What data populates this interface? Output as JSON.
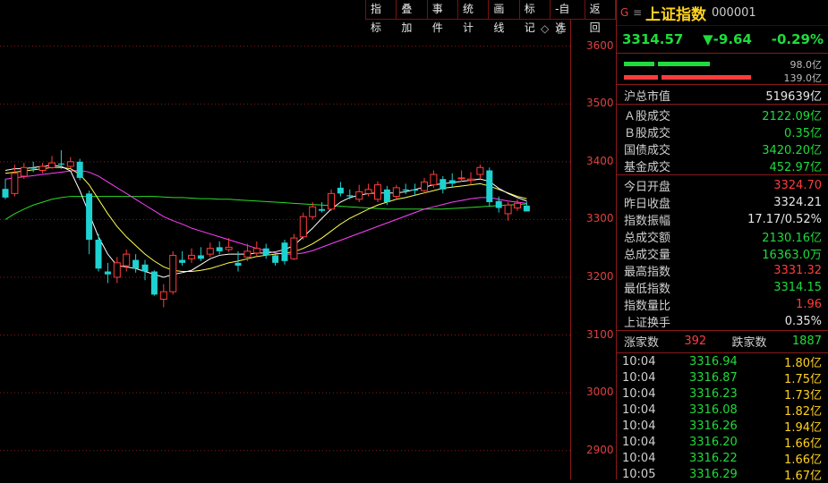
{
  "toolbar": [
    "指标",
    "叠加",
    "事件",
    "统计",
    "画线",
    "标记",
    "-自选",
    "返回"
  ],
  "chart_icons": [
    "◇",
    "▯"
  ],
  "chart_data": {
    "type": "candlestick",
    "y_ticks": [
      3600,
      3500,
      3400,
      3300,
      3200,
      3100,
      3000,
      2900
    ],
    "ylim": [
      2850,
      3680
    ],
    "candles": [
      {
        "o": 3353,
        "c": 3338,
        "h": 3370,
        "l": 3335
      },
      {
        "o": 3345,
        "c": 3380,
        "h": 3395,
        "l": 3340
      },
      {
        "o": 3375,
        "c": 3390,
        "h": 3398,
        "l": 3370
      },
      {
        "o": 3390,
        "c": 3388,
        "h": 3400,
        "l": 3382
      },
      {
        "o": 3385,
        "c": 3392,
        "h": 3398,
        "l": 3380
      },
      {
        "o": 3390,
        "c": 3398,
        "h": 3410,
        "l": 3388
      },
      {
        "o": 3397,
        "c": 3395,
        "h": 3420,
        "l": 3388
      },
      {
        "o": 3392,
        "c": 3400,
        "h": 3408,
        "l": 3388
      },
      {
        "o": 3400,
        "c": 3372,
        "h": 3405,
        "l": 3368
      },
      {
        "o": 3345,
        "c": 3265,
        "h": 3350,
        "l": 3240
      },
      {
        "o": 3265,
        "c": 3215,
        "h": 3275,
        "l": 3210
      },
      {
        "o": 3210,
        "c": 3205,
        "h": 3225,
        "l": 3190
      },
      {
        "o": 3200,
        "c": 3225,
        "h": 3235,
        "l": 3190
      },
      {
        "o": 3220,
        "c": 3240,
        "h": 3248,
        "l": 3210
      },
      {
        "o": 3230,
        "c": 3215,
        "h": 3240,
        "l": 3208
      },
      {
        "o": 3222,
        "c": 3210,
        "h": 3230,
        "l": 3195
      },
      {
        "o": 3210,
        "c": 3170,
        "h": 3212,
        "l": 3168
      },
      {
        "o": 3162,
        "c": 3175,
        "h": 3188,
        "l": 3148
      },
      {
        "o": 3175,
        "c": 3238,
        "h": 3245,
        "l": 3170
      },
      {
        "o": 3230,
        "c": 3225,
        "h": 3245,
        "l": 3220
      },
      {
        "o": 3232,
        "c": 3238,
        "h": 3250,
        "l": 3225
      },
      {
        "o": 3238,
        "c": 3232,
        "h": 3252,
        "l": 3228
      },
      {
        "o": 3240,
        "c": 3250,
        "h": 3260,
        "l": 3235
      },
      {
        "o": 3252,
        "c": 3245,
        "h": 3262,
        "l": 3240
      },
      {
        "o": 3248,
        "c": 3252,
        "h": 3268,
        "l": 3244
      },
      {
        "o": 3225,
        "c": 3220,
        "h": 3245,
        "l": 3210
      },
      {
        "o": 3235,
        "c": 3245,
        "h": 3258,
        "l": 3228
      },
      {
        "o": 3242,
        "c": 3250,
        "h": 3262,
        "l": 3236
      },
      {
        "o": 3250,
        "c": 3238,
        "h": 3258,
        "l": 3232
      },
      {
        "o": 3238,
        "c": 3225,
        "h": 3245,
        "l": 3220
      },
      {
        "o": 3260,
        "c": 3228,
        "h": 3265,
        "l": 3222
      },
      {
        "o": 3232,
        "c": 3268,
        "h": 3275,
        "l": 3230
      },
      {
        "o": 3270,
        "c": 3305,
        "h": 3312,
        "l": 3265
      },
      {
        "o": 3305,
        "c": 3322,
        "h": 3330,
        "l": 3300
      },
      {
        "o": 3318,
        "c": 3315,
        "h": 3330,
        "l": 3312
      },
      {
        "o": 3318,
        "c": 3345,
        "h": 3352,
        "l": 3315
      },
      {
        "o": 3355,
        "c": 3345,
        "h": 3365,
        "l": 3340
      },
      {
        "o": 3342,
        "c": 3340,
        "h": 3352,
        "l": 3335
      },
      {
        "o": 3335,
        "c": 3348,
        "h": 3360,
        "l": 3330
      },
      {
        "o": 3345,
        "c": 3352,
        "h": 3362,
        "l": 3340
      },
      {
        "o": 3335,
        "c": 3360,
        "h": 3366,
        "l": 3330
      },
      {
        "o": 3352,
        "c": 3330,
        "h": 3358,
        "l": 3325
      },
      {
        "o": 3340,
        "c": 3355,
        "h": 3360,
        "l": 3335
      },
      {
        "o": 3352,
        "c": 3350,
        "h": 3362,
        "l": 3344
      },
      {
        "o": 3352,
        "c": 3350,
        "h": 3362,
        "l": 3342
      },
      {
        "o": 3350,
        "c": 3365,
        "h": 3372,
        "l": 3345
      },
      {
        "o": 3360,
        "c": 3378,
        "h": 3385,
        "l": 3355
      },
      {
        "o": 3370,
        "c": 3352,
        "h": 3375,
        "l": 3345
      },
      {
        "o": 3368,
        "c": 3362,
        "h": 3380,
        "l": 3355
      },
      {
        "o": 3372,
        "c": 3372,
        "h": 3385,
        "l": 3365
      },
      {
        "o": 3368,
        "c": 3370,
        "h": 3382,
        "l": 3360
      },
      {
        "o": 3378,
        "c": 3390,
        "h": 3395,
        "l": 3370
      },
      {
        "o": 3385,
        "c": 3330,
        "h": 3390,
        "l": 3322
      },
      {
        "o": 3332,
        "c": 3320,
        "h": 3340,
        "l": 3312
      },
      {
        "o": 3310,
        "c": 3325,
        "h": 3330,
        "l": 3298
      },
      {
        "o": 3320,
        "c": 3328,
        "h": 3335,
        "l": 3315
      },
      {
        "o": 3324,
        "c": 3314,
        "h": 3331,
        "l": 3314
      }
    ],
    "ma5": [
      3385,
      3388,
      3388,
      3390,
      3392,
      3394,
      3392,
      3384,
      3350,
      3310,
      3270,
      3240,
      3220,
      3218,
      3215,
      3210,
      3205,
      3200,
      3205,
      3208,
      3212,
      3222,
      3232,
      3238,
      3240,
      3240,
      3240,
      3242,
      3242,
      3244,
      3248,
      3255,
      3270,
      3285,
      3302,
      3318,
      3330,
      3338,
      3342,
      3345,
      3346,
      3346,
      3346,
      3348,
      3352,
      3356,
      3360,
      3362,
      3364,
      3366,
      3368,
      3370,
      3366,
      3354,
      3345,
      3338,
      3332
    ],
    "ma10": [
      3380,
      3382,
      3384,
      3386,
      3388,
      3390,
      3390,
      3388,
      3378,
      3360,
      3335,
      3310,
      3288,
      3270,
      3255,
      3240,
      3228,
      3218,
      3212,
      3210,
      3210,
      3212,
      3215,
      3220,
      3225,
      3228,
      3232,
      3236,
      3238,
      3240,
      3242,
      3244,
      3250,
      3258,
      3268,
      3280,
      3292,
      3302,
      3310,
      3318,
      3325,
      3330,
      3335,
      3338,
      3342,
      3346,
      3350,
      3354,
      3356,
      3358,
      3360,
      3362,
      3358,
      3352,
      3346,
      3340,
      3336
    ],
    "ma20": [
      3370,
      3372,
      3374,
      3376,
      3378,
      3380,
      3382,
      3384,
      3385,
      3382,
      3375,
      3365,
      3355,
      3345,
      3335,
      3325,
      3315,
      3305,
      3298,
      3292,
      3285,
      3280,
      3275,
      3270,
      3265,
      3260,
      3255,
      3250,
      3246,
      3242,
      3240,
      3240,
      3242,
      3246,
      3252,
      3258,
      3264,
      3270,
      3276,
      3282,
      3288,
      3294,
      3300,
      3306,
      3312,
      3318,
      3322,
      3326,
      3330,
      3333,
      3336,
      3338,
      3338,
      3335,
      3332,
      3330,
      3328
    ],
    "ma60": [
      3300,
      3310,
      3318,
      3325,
      3330,
      3335,
      3338,
      3340,
      3340,
      3340,
      3340,
      3340,
      3340,
      3340,
      3340,
      3340,
      3340,
      3339,
      3338,
      3338,
      3337,
      3336,
      3336,
      3335,
      3335,
      3334,
      3333,
      3332,
      3331,
      3330,
      3329,
      3328,
      3327,
      3326,
      3325,
      3324,
      3323,
      3322,
      3321,
      3320,
      3319,
      3318,
      3318,
      3318,
      3318,
      3318,
      3318,
      3318,
      3319,
      3320,
      3321,
      3322,
      3323,
      3324,
      3325,
      3326,
      3327
    ]
  },
  "header": {
    "badge": "G",
    "menu": "≡",
    "name": "上证指数",
    "code": "000001"
  },
  "quote": {
    "price": "3314.57",
    "change": "▼-9.64",
    "pct": "-0.29%"
  },
  "bars": {
    "up_value": "98.0亿",
    "down_value": "139.0亿"
  },
  "stats_a": [
    {
      "label": "沪总市值",
      "value": "519639亿",
      "color": "white"
    }
  ],
  "stats_b": [
    {
      "label": "Ａ股成交",
      "value": "2122.09亿",
      "color": "green"
    },
    {
      "label": "Ｂ股成交",
      "value": "0.35亿",
      "color": "green"
    },
    {
      "label": "国债成交",
      "value": "3420.20亿",
      "color": "green"
    },
    {
      "label": "基金成交",
      "value": "452.97亿",
      "color": "green"
    }
  ],
  "stats_c": [
    {
      "label": "今日开盘",
      "value": "3324.70",
      "color": "red"
    },
    {
      "label": "昨日收盘",
      "value": "3324.21",
      "color": "white"
    },
    {
      "label": "指数振幅",
      "value": "17.17/0.52%",
      "color": "white"
    },
    {
      "label": "总成交额",
      "value": "2130.16亿",
      "color": "green"
    },
    {
      "label": "总成交量",
      "value": "16363.0万",
      "color": "green"
    },
    {
      "label": "最高指数",
      "value": "3331.32",
      "color": "red"
    },
    {
      "label": "最低指数",
      "value": "3314.15",
      "color": "green"
    },
    {
      "label": "指数量比",
      "value": "1.96",
      "color": "red"
    },
    {
      "label": "上证换手",
      "value": "0.35%",
      "color": "white"
    }
  ],
  "breadth": {
    "up_label": "涨家数",
    "up_value": "392",
    "down_label": "跌家数",
    "down_value": "1887"
  },
  "ticks": [
    {
      "t": "10:04",
      "p": "3316.94",
      "v": "1.80亿"
    },
    {
      "t": "10:04",
      "p": "3316.87",
      "v": "1.75亿"
    },
    {
      "t": "10:04",
      "p": "3316.23",
      "v": "1.73亿"
    },
    {
      "t": "10:04",
      "p": "3316.08",
      "v": "1.82亿"
    },
    {
      "t": "10:04",
      "p": "3316.26",
      "v": "1.94亿"
    },
    {
      "t": "10:04",
      "p": "3316.20",
      "v": "1.66亿"
    },
    {
      "t": "10:04",
      "p": "3316.22",
      "v": "1.66亿"
    },
    {
      "t": "10:05",
      "p": "3316.29",
      "v": "1.67亿"
    }
  ],
  "colors": {
    "up": "#ff3c3c",
    "down": "#1ed2d2",
    "ma5": "#ffffff",
    "ma10": "#ffff50",
    "ma20": "#ff40ff",
    "ma60": "#2adc2a",
    "grid": "#8a1a1a"
  }
}
